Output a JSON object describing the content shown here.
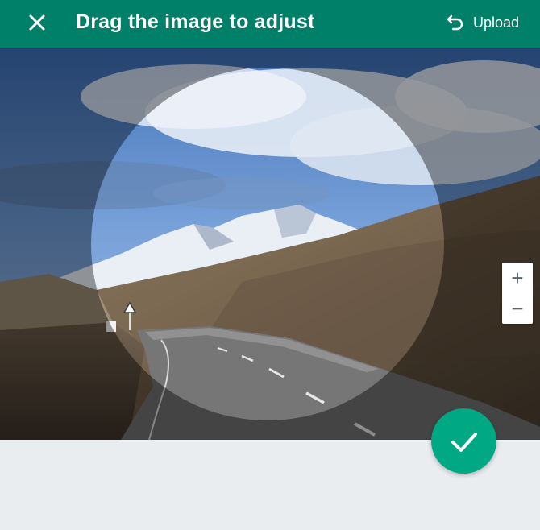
{
  "header": {
    "title": "Drag the image to adjust",
    "upload_label": "Upload",
    "close_icon": "close-icon",
    "upload_icon": "undo-arrow-icon",
    "background_color": "#008069"
  },
  "zoom": {
    "zoom_in_label": "+",
    "zoom_out_label": "−"
  },
  "confirm": {
    "icon": "checkmark-icon",
    "color": "#00a884"
  }
}
